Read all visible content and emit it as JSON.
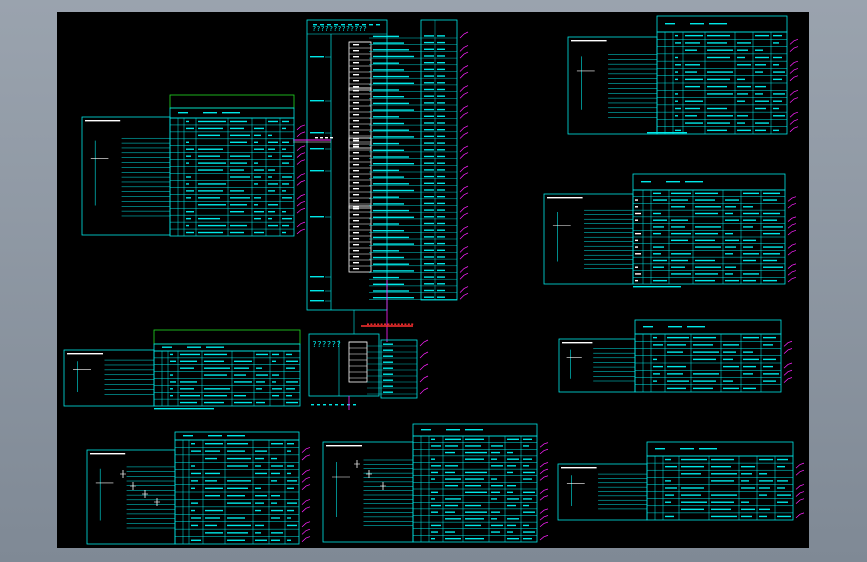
{
  "window": {
    "title": ""
  },
  "drawing": {
    "top_note": "?????????????",
    "bus_label": "??????",
    "colors": {
      "background": "#000000",
      "frame_grey": "#8d97a3",
      "line_cyan": "#00e8e8",
      "green": "#22dd22",
      "magenta": "#ff22ff",
      "red": "#ff3030",
      "white": "#ffffff"
    }
  }
}
